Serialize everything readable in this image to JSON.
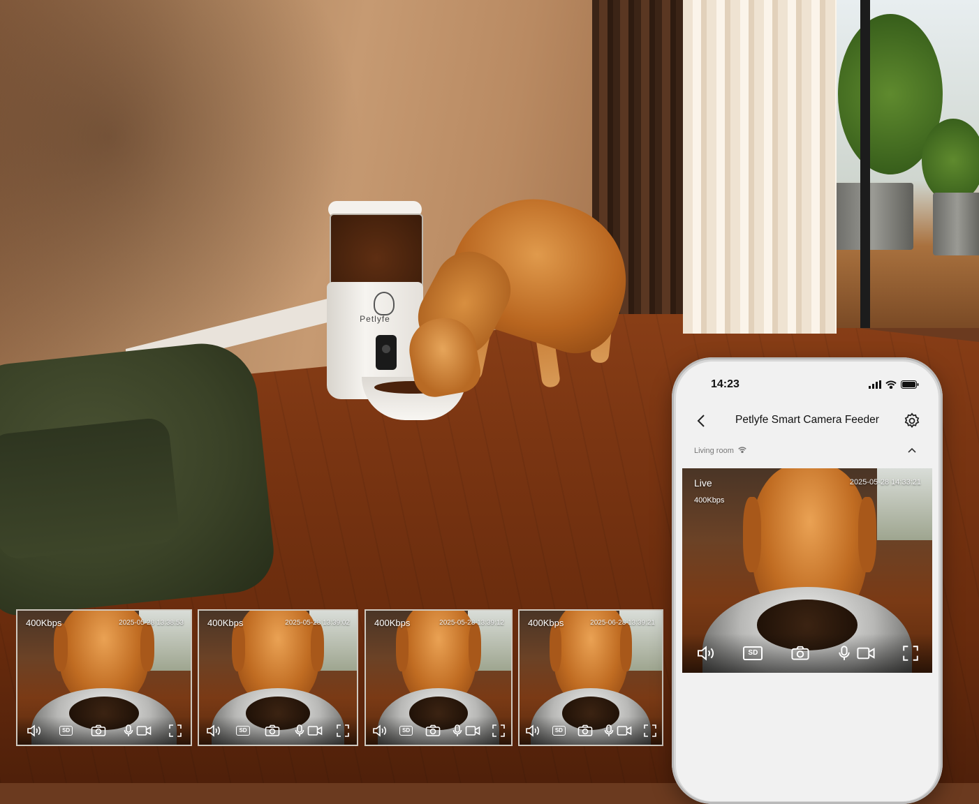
{
  "feeder": {
    "brand": "Petlyfe"
  },
  "thumbnails": [
    {
      "bitrate": "400Kbps",
      "timestamp": "2025-05-28 13:38:53"
    },
    {
      "bitrate": "400Kbps",
      "timestamp": "2025-05-28 13:39:02"
    },
    {
      "bitrate": "400Kbps",
      "timestamp": "2025-05-28 13:39:12"
    },
    {
      "bitrate": "400Kbps",
      "timestamp": "2025-06-28 13:39:21"
    }
  ],
  "phone": {
    "status_time": "14:23",
    "title": "Petlyfe Smart Camera Feeder",
    "location": "Living room",
    "live": {
      "label": "Live",
      "bitrate": "400Kbps",
      "timestamp": "2025-05-28 14:33:21"
    }
  },
  "controls": {
    "sd_label": "SD",
    "icons": [
      "speaker-icon",
      "sd-badge",
      "camera-icon",
      "microphone-icon",
      "video-record-icon",
      "fullscreen-icon"
    ]
  },
  "colors": {
    "floor": "#7a3512",
    "wall": "#c69a72",
    "dog": "#c06c22",
    "screen": "#f1f1f1"
  }
}
